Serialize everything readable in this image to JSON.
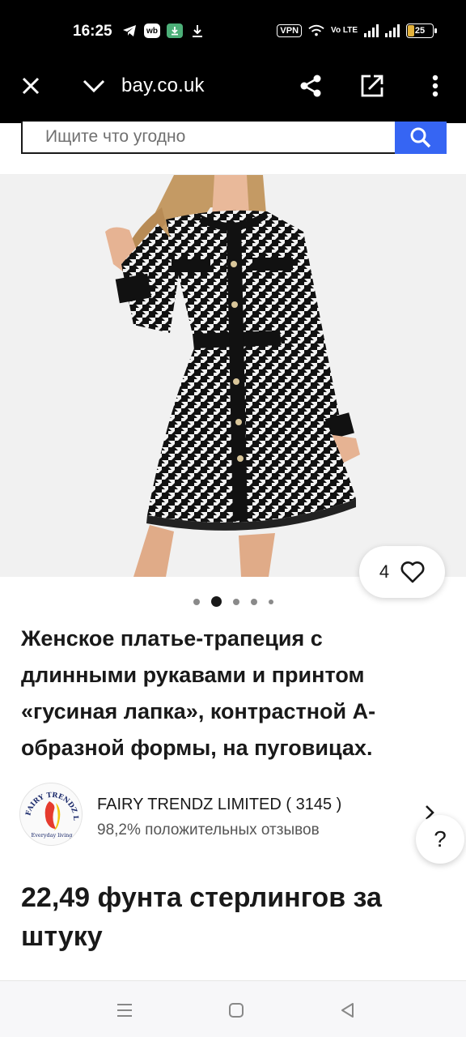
{
  "status_bar": {
    "time": "16:25",
    "wb_label": "wb",
    "vpn_label": "VPN",
    "volte_label": "Vo LTE",
    "battery": "25",
    "battery_level": 0.25
  },
  "browser": {
    "url": "bay.co.uk",
    "icons": [
      "close-icon",
      "chevron-down-icon",
      "share-icon",
      "open-external-icon",
      "more-vertical-icon"
    ]
  },
  "search": {
    "placeholder": "Ищите что угодно",
    "button_icon": "search-icon"
  },
  "product": {
    "watch_count": "4",
    "image_count": 5,
    "active_image": 2,
    "title": "Женское платье-трапеция с длинными рукавами и принтом «гусиная лапка», контрастной А-образной формы, на пуговицах.",
    "price": "22,49 фунта стерлингов за штуку"
  },
  "seller": {
    "logo_text_top": "FAIRY TRENDZ LTD",
    "logo_text_bottom": "Everyday living",
    "name": "FAIRY TRENDZ LIMITED ( 3145 )",
    "feedback": "98,2% положительных отзывов"
  },
  "help": {
    "label": "?"
  },
  "colors": {
    "accent": "#3665f3",
    "text": "#191919",
    "top_bar": "#000000"
  }
}
